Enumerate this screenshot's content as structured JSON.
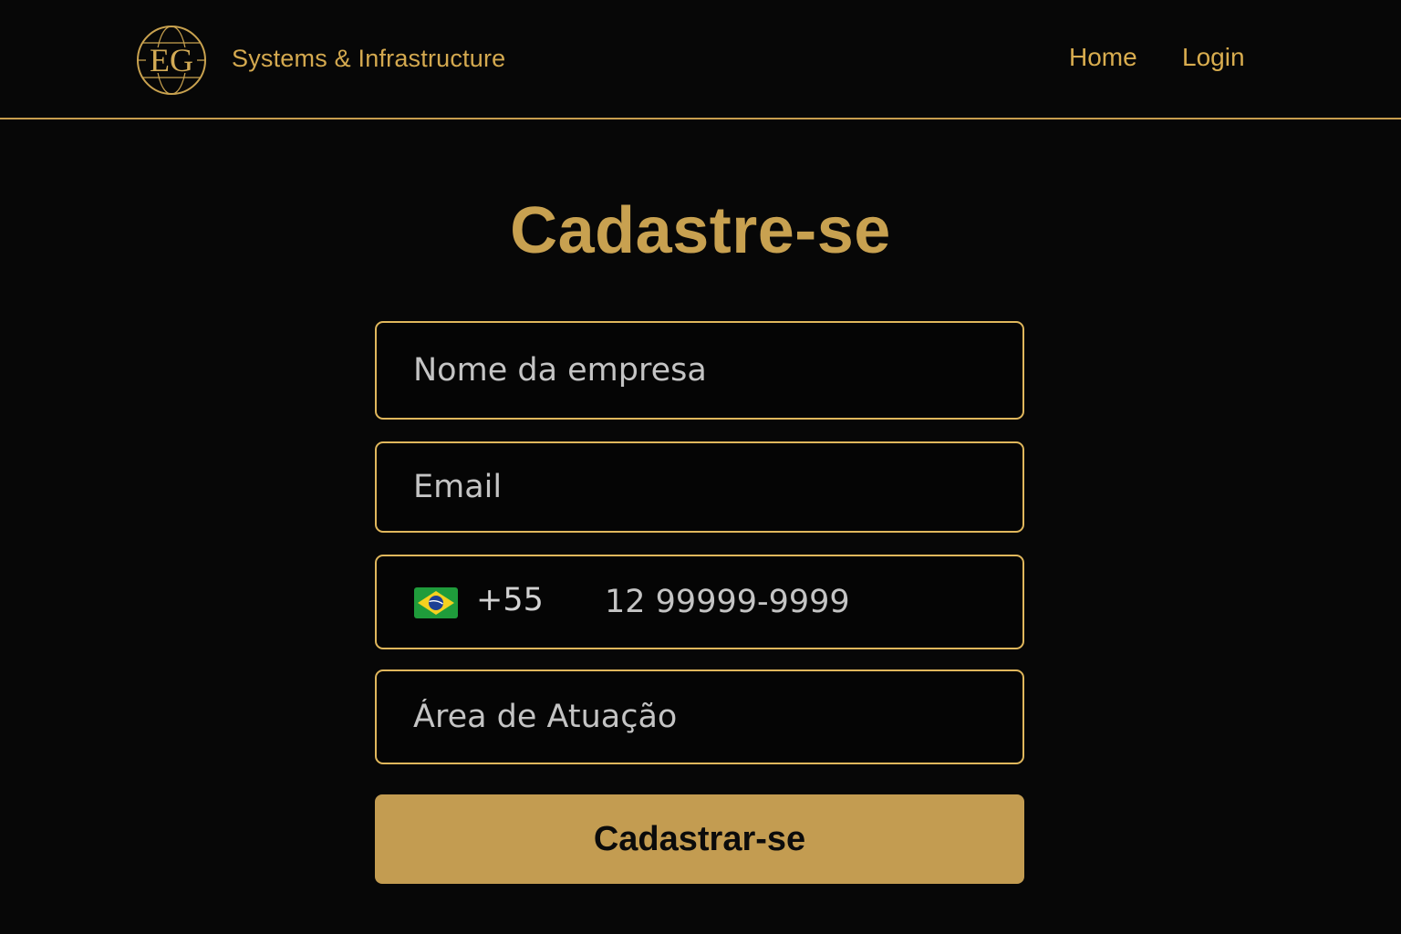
{
  "header": {
    "logo_text": "EG",
    "brand": "Systems & Infrastructure",
    "nav": {
      "home": "Home",
      "login": "Login"
    }
  },
  "main": {
    "title": "Cadastre-se",
    "form": {
      "company_placeholder": "Nome da empresa",
      "email_placeholder": "Email",
      "phone": {
        "flag_icon": "brazil-flag-icon",
        "dial_code": "+55",
        "placeholder": "12 99999-9999"
      },
      "area_placeholder": "Área de Atuação",
      "submit_label": "Cadastrar-se"
    }
  },
  "colors": {
    "background": "#070707",
    "accent_gold": "#c8a150",
    "field_border": "#e0b75c",
    "button_bg": "#c39c51"
  }
}
